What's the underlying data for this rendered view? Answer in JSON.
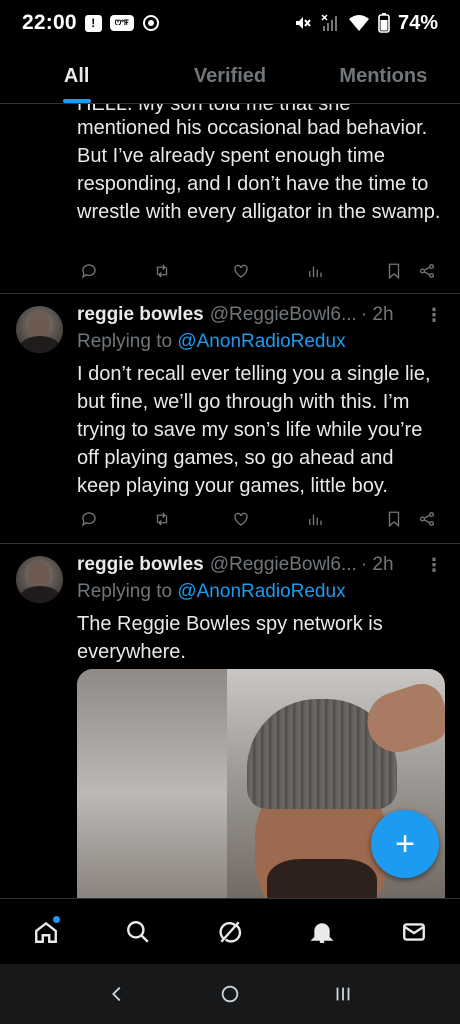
{
  "status_bar": {
    "time": "22:00",
    "notif_badge": "!",
    "app_badge": "ꯁꯦꯝ",
    "battery": "74%"
  },
  "tabs": [
    {
      "label": "All",
      "active": true
    },
    {
      "label": "Verified",
      "active": false
    },
    {
      "label": "Mentions",
      "active": false
    }
  ],
  "tweets": [
    {
      "partial_top": "HELL. My son told me that she",
      "text": "mentioned his occasional bad behavior. But I’ve already spent enough time responding, and I don’t have the time to wrestle with every alligator in the swamp."
    },
    {
      "name": "reggie bowles",
      "handle": "@ReggieBowl6...",
      "time": "· 2h",
      "replying_prefix": "Replying to",
      "replying_to": "@AnonRadioRedux",
      "text": "I don’t recall ever telling you a single lie, but fine, we’ll go through with this. I’m trying to save my son’s life while you’re off playing games, so go ahead and keep playing your games, little boy."
    },
    {
      "name": "reggie bowles",
      "handle": "@ReggieBowl6...",
      "time": "· 2h",
      "replying_prefix": "Replying to",
      "replying_to": "@AnonRadioRedux",
      "text": "The Reggie Bowles spy network is everywhere."
    }
  ],
  "fab_label": "+",
  "more_glyph": "⋮",
  "colors": {
    "accent": "#1d9bf0",
    "background": "#000000",
    "text_primary": "#e7e9ea",
    "text_secondary": "#71767b",
    "divider": "#2f3336"
  }
}
